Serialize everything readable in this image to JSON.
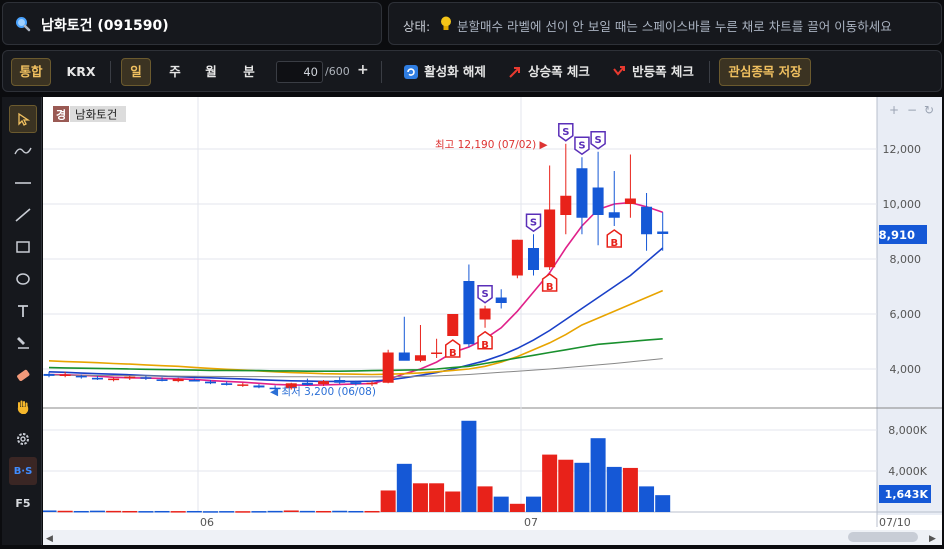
{
  "stock": {
    "name_label": "남화토건 (091590)",
    "badge": "경",
    "short_name": "남화토건"
  },
  "status": {
    "label": "상태:",
    "message": "분할매수 라벨에 선이 안 보일 때는 스페이스바를 누른 채로 차트를 끌어 이동하세요"
  },
  "toolbar": {
    "combined": "통합",
    "exchange": "KRX",
    "periods": [
      "일",
      "주",
      "월",
      "분"
    ],
    "count_value": "40",
    "count_max": "/600",
    "plus": "+",
    "deactivate": "활성화 해제",
    "rise_check": "상승폭 체크",
    "rebound_check": "반등폭 체크",
    "watchlist_save": "관심종목 저장"
  },
  "left_tools": [
    "cursor-tool",
    "curve-tool",
    "horizontal-line-tool",
    "trend-line-tool",
    "rectangle-tool",
    "ellipse-tool",
    "text-tool",
    "brush-tool",
    "eraser-tool",
    "hand-tool",
    "settings-tool",
    "buy-sell-tool",
    "f5-tool"
  ],
  "left_tools_labels": {
    "bs": "B·S",
    "f5": "F5"
  },
  "chart": {
    "price_ticks": [
      "12,000",
      "10,000",
      "8,000",
      "6,000",
      "4,000"
    ],
    "volume_ticks": [
      "8,000K",
      "4,000K"
    ],
    "current_price": "8,910",
    "current_volume": "1,643K",
    "high_label": "최고 12,190 (07/02) ▶",
    "low_label": "◀ 최저 3,200 (06/08)",
    "date_labels": [
      "06",
      "07"
    ],
    "last_date": "07/10",
    "zoom_buttons": [
      "+",
      "−",
      "↻"
    ],
    "colors": {
      "up": "#e8221a",
      "down": "#1558d6",
      "ma5": "#e0218a",
      "ma20": "#1a40c8",
      "ma60": "#e8a400",
      "ma120": "#19902e",
      "ma240": "#888888"
    }
  },
  "chart_data": {
    "type": "candlestick",
    "price_ylim": [
      3000,
      13000
    ],
    "candles": [
      {
        "o": 3820,
        "h": 3900,
        "l": 3700,
        "c": 3750,
        "v": 150
      },
      {
        "o": 3780,
        "h": 3900,
        "l": 3700,
        "c": 3800,
        "v": 120
      },
      {
        "o": 3750,
        "h": 3800,
        "l": 3650,
        "c": 3700,
        "v": 100
      },
      {
        "o": 3680,
        "h": 3750,
        "l": 3600,
        "c": 3620,
        "v": 130
      },
      {
        "o": 3600,
        "h": 3700,
        "l": 3550,
        "c": 3650,
        "v": 110
      },
      {
        "o": 3680,
        "h": 3750,
        "l": 3600,
        "c": 3720,
        "v": 100
      },
      {
        "o": 3700,
        "h": 3750,
        "l": 3600,
        "c": 3650,
        "v": 90
      },
      {
        "o": 3620,
        "h": 3700,
        "l": 3550,
        "c": 3580,
        "v": 100
      },
      {
        "o": 3560,
        "h": 3680,
        "l": 3520,
        "c": 3640,
        "v": 90
      },
      {
        "o": 3600,
        "h": 3650,
        "l": 3550,
        "c": 3560,
        "v": 100
      },
      {
        "o": 3540,
        "h": 3600,
        "l": 3450,
        "c": 3480,
        "v": 80
      },
      {
        "o": 3480,
        "h": 3550,
        "l": 3400,
        "c": 3420,
        "v": 90
      },
      {
        "o": 3420,
        "h": 3500,
        "l": 3350,
        "c": 3440,
        "v": 80
      },
      {
        "o": 3400,
        "h": 3450,
        "l": 3300,
        "c": 3330,
        "v": 90
      },
      {
        "o": 3320,
        "h": 3400,
        "l": 3200,
        "c": 3280,
        "v": 110
      },
      {
        "o": 3300,
        "h": 3500,
        "l": 3250,
        "c": 3480,
        "v": 150
      },
      {
        "o": 3500,
        "h": 3650,
        "l": 3400,
        "c": 3420,
        "v": 110
      },
      {
        "o": 3450,
        "h": 3600,
        "l": 3380,
        "c": 3560,
        "v": 100
      },
      {
        "o": 3600,
        "h": 3700,
        "l": 3450,
        "c": 3500,
        "v": 120
      },
      {
        "o": 3520,
        "h": 3580,
        "l": 3400,
        "c": 3450,
        "v": 100
      },
      {
        "o": 3450,
        "h": 3550,
        "l": 3380,
        "c": 3500,
        "v": 100
      },
      {
        "o": 3500,
        "h": 4700,
        "l": 3480,
        "c": 4600,
        "v": 2100
      },
      {
        "o": 4600,
        "h": 5900,
        "l": 4400,
        "c": 4300,
        "v": 4700
      },
      {
        "o": 4300,
        "h": 5600,
        "l": 4250,
        "c": 4500,
        "v": 2800
      },
      {
        "o": 4550,
        "h": 5100,
        "l": 4400,
        "c": 4600,
        "v": 2800
      },
      {
        "o": 5200,
        "h": 6000,
        "l": 5200,
        "c": 6000,
        "v": 2000
      },
      {
        "o": 7200,
        "h": 7800,
        "l": 4800,
        "c": 4900,
        "v": 8900
      },
      {
        "o": 5800,
        "h": 6300,
        "l": 5500,
        "c": 6200,
        "v": 2500
      },
      {
        "o": 6600,
        "h": 6900,
        "l": 6200,
        "c": 6400,
        "v": 1500
      },
      {
        "o": 7400,
        "h": 8700,
        "l": 7300,
        "c": 8700,
        "v": 800
      },
      {
        "o": 8400,
        "h": 8900,
        "l": 7400,
        "c": 7600,
        "v": 1500
      },
      {
        "o": 7700,
        "h": 11400,
        "l": 7600,
        "c": 9800,
        "v": 5600
      },
      {
        "o": 9600,
        "h": 12190,
        "l": 8900,
        "c": 10300,
        "v": 5100
      },
      {
        "o": 11300,
        "h": 11700,
        "l": 8900,
        "c": 9500,
        "v": 4800
      },
      {
        "o": 10600,
        "h": 11900,
        "l": 8500,
        "c": 9600,
        "v": 7200
      },
      {
        "o": 9700,
        "h": 11200,
        "l": 9200,
        "c": 9500,
        "v": 4400
      },
      {
        "o": 10000,
        "h": 11800,
        "l": 9500,
        "c": 10200,
        "v": 4300
      },
      {
        "o": 9900,
        "h": 10400,
        "l": 8300,
        "c": 8900,
        "v": 2500
      },
      {
        "o": 9000,
        "h": 9700,
        "l": 8300,
        "c": 8910,
        "v": 1643
      }
    ],
    "volume_unit": "K",
    "series": [
      {
        "name": "MA5",
        "values": [
          3800,
          3790,
          3770,
          3740,
          3700,
          3680,
          3670,
          3660,
          3640,
          3620,
          3580,
          3550,
          3520,
          3480,
          3440,
          3420,
          3410,
          3420,
          3440,
          3460,
          3470,
          3620,
          3820,
          4000,
          4250,
          4600,
          4800,
          5100,
          5500,
          6100,
          6800,
          7500,
          8400,
          9200,
          9800,
          10000,
          10050,
          9900,
          9700
        ]
      },
      {
        "name": "MA20",
        "values": [
          3900,
          3880,
          3850,
          3830,
          3810,
          3790,
          3760,
          3740,
          3720,
          3700,
          3680,
          3660,
          3640,
          3610,
          3590,
          3570,
          3560,
          3550,
          3550,
          3550,
          3560,
          3600,
          3680,
          3770,
          3870,
          4000,
          4150,
          4300,
          4500,
          4750,
          5050,
          5400,
          5800,
          6200,
          6600,
          7000,
          7400,
          7900,
          8400
        ]
      },
      {
        "name": "MA60",
        "values": [
          4300,
          4270,
          4250,
          4230,
          4200,
          4180,
          4150,
          4120,
          4100,
          4060,
          4020,
          3990,
          3960,
          3930,
          3900,
          3870,
          3850,
          3830,
          3820,
          3810,
          3800,
          3810,
          3830,
          3860,
          3900,
          3950,
          4000,
          4100,
          4250,
          4450,
          4700,
          4950,
          5250,
          5600,
          5850,
          6100,
          6350,
          6600,
          6850
        ]
      },
      {
        "name": "MA120",
        "values": [
          4050,
          4040,
          4030,
          4020,
          4010,
          4000,
          3990,
          3980,
          3970,
          3960,
          3950,
          3950,
          3940,
          3940,
          3930,
          3930,
          3920,
          3920,
          3920,
          3930,
          3940,
          3950,
          3960,
          3970,
          4000,
          4050,
          4100,
          4200,
          4300,
          4400,
          4500,
          4600,
          4700,
          4800,
          4900,
          4950,
          5000,
          5050,
          5100
        ]
      },
      {
        "name": "MA240",
        "values": [
          3780,
          3775,
          3770,
          3765,
          3760,
          3755,
          3750,
          3745,
          3740,
          3735,
          3730,
          3728,
          3725,
          3722,
          3720,
          3718,
          3716,
          3714,
          3712,
          3712,
          3714,
          3718,
          3725,
          3735,
          3750,
          3770,
          3800,
          3840,
          3880,
          3920,
          3960,
          4000,
          4050,
          4100,
          4150,
          4200,
          4260,
          4320,
          4380
        ]
      }
    ],
    "buy_sell_markers": [
      {
        "i": 27,
        "type": "S"
      },
      {
        "i": 30,
        "type": "S"
      },
      {
        "i": 31,
        "type": "B"
      },
      {
        "i": 32,
        "type": "S"
      },
      {
        "i": 33,
        "type": "S"
      },
      {
        "i": 34,
        "type": "S"
      },
      {
        "i": 35,
        "type": "B"
      },
      {
        "i": 25,
        "type": "B"
      },
      {
        "i": 27,
        "type": "B"
      }
    ]
  }
}
